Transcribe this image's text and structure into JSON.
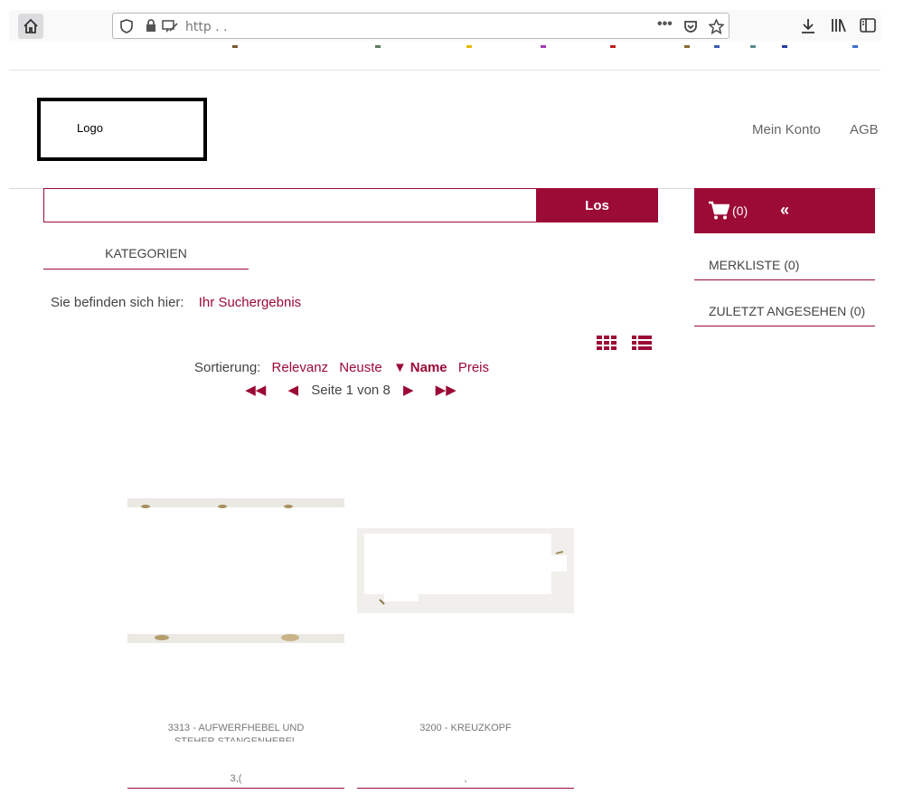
{
  "browser": {
    "url_text": "http  . .",
    "icons": [
      "home-icon",
      "shield-icon",
      "lock-icon",
      "tracking-icon",
      "more-icon",
      "pocket-icon",
      "star-icon",
      "download-icon",
      "library-icon",
      "sidebar-icon"
    ]
  },
  "header": {
    "logo_text": "Logo",
    "nav": [
      "Mein Konto",
      "AGB"
    ]
  },
  "search": {
    "placeholder": "",
    "button_label": "Los"
  },
  "cart": {
    "count": "(0)",
    "collapse": "«"
  },
  "sidebar": {
    "merkliste": "MERKLISTE (0)",
    "zuletzt": "ZULETZT ANGESEHEN (0)"
  },
  "kategorien_label": "KATEGORIEN",
  "breadcrumb": {
    "prefix": "Sie befinden sich hier:",
    "current": "Ihr Suchergebnis"
  },
  "sort": {
    "label": "Sortierung:",
    "options": [
      "Relevanz",
      "Neuste",
      "Name",
      "Preis"
    ],
    "active_marker": "▼"
  },
  "pager": {
    "first": "◀◀",
    "prev": "◀",
    "text": "Seite 1 von 8",
    "next": "▶",
    "last": "▶▶"
  },
  "products": [
    {
      "title_line1": "3313 - AUFWERFHEBEL UND",
      "title_line2": "STEHER STANGENHEBEL",
      "sub": "3,("
    },
    {
      "title_line1": "3200 - KREUZKOPF",
      "title_line2": "",
      "sub": ","
    }
  ],
  "colors": {
    "accent": "#9c0a36"
  }
}
